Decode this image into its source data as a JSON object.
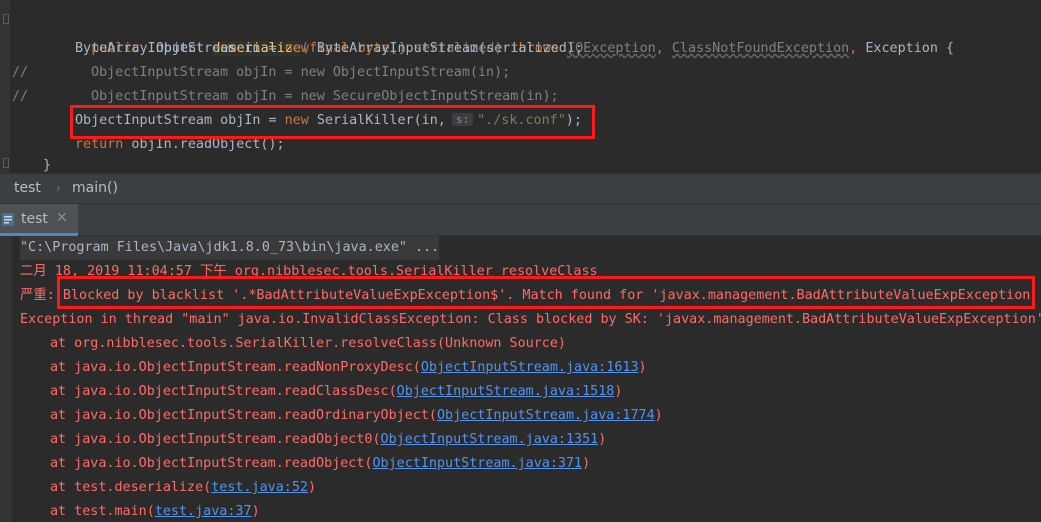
{
  "editor": {
    "line1": {
      "kw_public": "public",
      "type": "Object",
      "method": "deserialize",
      "paren_open": "(",
      "kw_final": "final",
      "kw_byte": "byte",
      "param": "[] serialized)",
      "kw_throws": "throws",
      "exc1": "IOException",
      "comma1": ",",
      "exc2": "ClassNotFoundException",
      "comma2": ",",
      "exc3": "Exception {"
    },
    "line2": {
      "decl": "ByteArrayInputStream in = ",
      "kw_new": "new",
      "rest": " ByteArrayInputStream(serialized);"
    },
    "line3": {
      "comment_marker": "//",
      "text": "ObjectInputStream objIn = new ObjectInputStream(in);"
    },
    "line4": {
      "comment_marker": "//",
      "text": "ObjectInputStream objIn = new SecureObjectInputStream(in);"
    },
    "line5": {
      "decl": "ObjectInputStream objIn = ",
      "kw_new": "new",
      "call": " SerialKiller(in,",
      "hint": "s:",
      "arg": "\"./sk.conf\"",
      "end": ");"
    },
    "line6": {
      "kw_return": "return",
      "rest": " objIn.readObject();"
    },
    "line7": {
      "brace": "}"
    }
  },
  "breadcrumb": {
    "item1": "test",
    "separator": "›",
    "item2": "main()"
  },
  "run_tab": {
    "label": "test",
    "close": "✕"
  },
  "console": {
    "cmd": "\"C:\\Program Files\\Java\\jdk1.8.0_73\\bin\\java.exe\" ...",
    "log_time": "二月 18, 2019 11:04:57 下午 org.nibblesec.tools.SerialKiller resolveClass",
    "severe_prefix": "严重:",
    "severe_msg": " Blocked by blacklist '.*BadAttributeValueExpException$'. Match found for 'javax.management.BadAttributeValueExpException'",
    "exception": "Exception in thread \"main\" java.io.InvalidClassException: Class blocked by SK: 'javax.management.BadAttributeValueExpException'",
    "trace": [
      {
        "prefix": "at org.nibblesec.tools.SerialKiller.resolveClass(Unknown Source)",
        "link": "",
        "suffix": ""
      },
      {
        "prefix": "at java.io.ObjectInputStream.readNonProxyDesc(",
        "link": "ObjectInputStream.java:1613",
        "suffix": ")"
      },
      {
        "prefix": "at java.io.ObjectInputStream.readClassDesc(",
        "link": "ObjectInputStream.java:1518",
        "suffix": ")"
      },
      {
        "prefix": "at java.io.ObjectInputStream.readOrdinaryObject(",
        "link": "ObjectInputStream.java:1774",
        "suffix": ")"
      },
      {
        "prefix": "at java.io.ObjectInputStream.readObject0(",
        "link": "ObjectInputStream.java:1351",
        "suffix": ")"
      },
      {
        "prefix": "at java.io.ObjectInputStream.readObject(",
        "link": "ObjectInputStream.java:371",
        "suffix": ")"
      },
      {
        "prefix": "at test.deserialize(",
        "link": "test.java:52",
        "suffix": ")"
      },
      {
        "prefix": "at test.main(",
        "link": "test.java:37",
        "suffix": ")"
      }
    ]
  },
  "colors": {
    "keyword": "#cc7832",
    "method": "#ffc66d",
    "string": "#6a8759",
    "error_text": "#ff6b68",
    "link": "#5394ec",
    "highlight_box": "#ff1a1a"
  }
}
